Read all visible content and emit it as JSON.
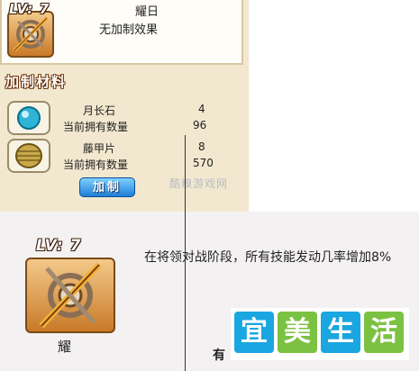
{
  "item_header": {
    "level_badge": "LV: 7",
    "name": "耀日",
    "effect": "无加制效果"
  },
  "materials_section": {
    "title": "加制材料",
    "items": [
      {
        "icon": "moonstone-icon",
        "name": "月长石",
        "required": "4",
        "owned_label": "当前拥有数量",
        "owned": "96"
      },
      {
        "icon": "rattan-armor-icon",
        "name": "藤甲片",
        "required": "8",
        "owned_label": "当前拥有数量",
        "owned": "570"
      }
    ],
    "craft_button": "加制"
  },
  "watermark": "酷糗游戏网",
  "tooltip": {
    "level_badge": "LV: 7",
    "description": "在将领对战阶段，所有技能发动几率增加8%",
    "name": "耀",
    "cut_text": "有"
  },
  "logo": {
    "chars": [
      "宜",
      "美",
      "生",
      "活"
    ],
    "colors": [
      "#1aa6e0",
      "#7cc242",
      "#1aa6e0",
      "#7cc242"
    ]
  }
}
